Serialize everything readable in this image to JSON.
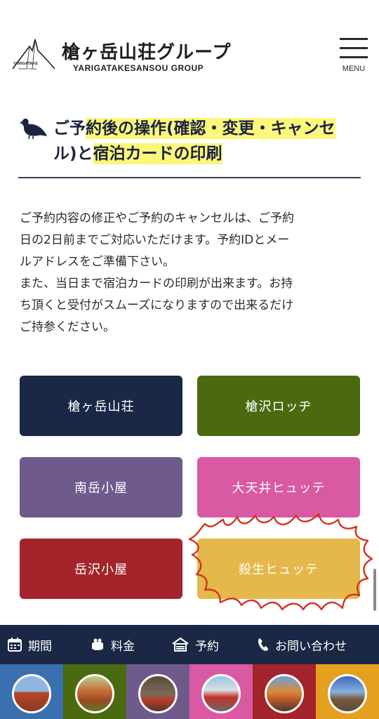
{
  "header": {
    "logo_jp": "槍ヶ岳山荘グループ",
    "logo_en": "YARIGATAKESANSOU GROUP",
    "logo_small_top": "YARIGATAKE",
    "logo_small_bottom": "Sansou Group",
    "menu_label": "MENU"
  },
  "section": {
    "title_line1_plain": "ご予約後の操作(確認・変更・キャンセ",
    "title_line2_plain": "ル)と",
    "title_line2_highlight": "宿泊カードの印刷",
    "title_line1_highlight_part": "約後の操作(確認・変更・キャンセ",
    "description": [
      "ご予約内容の修正やご予約のキャンセルは、ご予約",
      "日の2日前までご対応いただけます。予約IDとメー",
      "ルアドレスをご準備下さい。",
      "また、当日まで宿泊カードの印刷が出来ます。お持",
      "ち頂くと受付がスムーズになりますので出来るだけ",
      "ご持参ください。"
    ]
  },
  "lodges": [
    {
      "label": "槍ヶ岳山荘",
      "color": "#1a2745"
    },
    {
      "label": "槍沢ロッヂ",
      "color": "#4b6a10"
    },
    {
      "label": "南岳小屋",
      "color": "#6f5a8c"
    },
    {
      "label": "大天井ヒュッテ",
      "color": "#d95aa2"
    },
    {
      "label": "岳沢小屋",
      "color": "#a3242a"
    },
    {
      "label": "殺生ヒュッテ",
      "color": "#e4b84a"
    }
  ],
  "bottom_nav": {
    "period": "期間",
    "price": "料金",
    "reserve": "予約",
    "contact": "お問い合わせ"
  },
  "photo_strip": {
    "colors": [
      "#3a6fb0",
      "#4b6a10",
      "#6f5a8c",
      "#d95aa2",
      "#a3242a",
      "#e4a020"
    ]
  },
  "colors": {
    "highlight": "#fbf77a",
    "navy": "#1a2745",
    "scribble": "#d0341f"
  }
}
